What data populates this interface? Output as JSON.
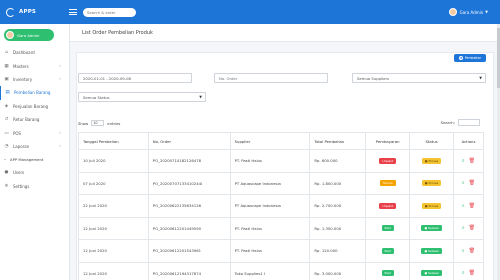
{
  "app": {
    "brand": "APPS"
  },
  "topbar": {
    "search_placeholder": "Search & enter",
    "user_name": "Gara Admin"
  },
  "sidebar": {
    "user": "Gara Admin",
    "items": [
      {
        "label": "Dashboard",
        "icon": "home-icon",
        "chevron": false
      },
      {
        "label": "Masters",
        "icon": "grid-icon",
        "chevron": true
      },
      {
        "label": "Inventory",
        "icon": "box-icon",
        "chevron": true
      },
      {
        "label": "Pembelian Barang",
        "icon": "cart-icon",
        "chevron": false,
        "active": true
      },
      {
        "label": "Penjualan Barang",
        "icon": "tag-icon",
        "chevron": false
      },
      {
        "label": "Retur Barang",
        "icon": "return-icon",
        "chevron": false
      },
      {
        "label": "POS",
        "icon": "pos-icon",
        "chevron": true
      },
      {
        "label": "Laporan",
        "icon": "report-icon",
        "chevron": true
      }
    ],
    "section": "APP Management",
    "mgmt_items": [
      {
        "label": "Users",
        "icon": "users-icon"
      },
      {
        "label": "Settings",
        "icon": "gear-icon"
      }
    ]
  },
  "page": {
    "title": "List Order Pembelian Produk",
    "add_button": "Pembelian"
  },
  "filters": {
    "date_range": "2020-01-01 - 2020-09-08",
    "order_placeholder": "No. Order",
    "supplier": "Semua Suppliers",
    "status": "Semua Status"
  },
  "datatable": {
    "show_label": "Show",
    "length": "10",
    "entries_label": "entries",
    "search_label": "Search:"
  },
  "table": {
    "headers": [
      "Tanggal Pembelian",
      "No. Order",
      "Supplier",
      "Total Pembelian",
      "Pembayaran",
      "Status",
      "Actions"
    ],
    "rows": [
      {
        "date": "10 Juli 2020",
        "order": "PO_20200710182126478",
        "supplier": "PT. Pasti Halus",
        "total": "Rp. 600.000",
        "payment": "Unpaid",
        "payment_type": "unpaid",
        "status": "Proses",
        "status_type": "proses"
      },
      {
        "date": "07 Juli 2020",
        "order": "PO_20200707133410244I",
        "supplier": "PT Aquascape Indonesia",
        "total": "Rp. 1.800.000",
        "payment": "Tempo",
        "payment_type": "tempo",
        "status": "Proses",
        "status_type": "proses"
      },
      {
        "date": "22 Juni 2020",
        "order": "PO_20200622135634126",
        "supplier": "PT Aquascape Indonesia",
        "total": "Rp. 2.700.000",
        "payment": "Unpaid",
        "payment_type": "unpaid",
        "status": "Proses",
        "status_type": "proses"
      },
      {
        "date": "12 Juni 2020",
        "order": "PO_20200612201449590",
        "supplier": "PT. Pasti Halus",
        "total": "Rp. 1.350.000",
        "payment": "Paid",
        "payment_type": "lunas",
        "status": "Selesai",
        "status_type": "selesai"
      },
      {
        "date": "12 Juni 2020",
        "order": "PO_20200612201543961",
        "supplier": "PT. Pasti Halus",
        "total": "Rp. 120.000",
        "payment": "Paid",
        "payment_type": "lunas",
        "status": "Selesai",
        "status_type": "selesai"
      },
      {
        "date": "12 Juni 2020",
        "order": "PO_20200612194317874",
        "supplier": "Toko Supplies1 I",
        "total": "Rp. 3.000.000",
        "payment": "Paid",
        "payment_type": "lunas",
        "status": "Selesai",
        "status_type": "selesai"
      }
    ]
  },
  "colors": {
    "primary": "#1d75d8",
    "success": "#2fbf71",
    "danger": "#e8414a",
    "warning": "#f4a300"
  }
}
